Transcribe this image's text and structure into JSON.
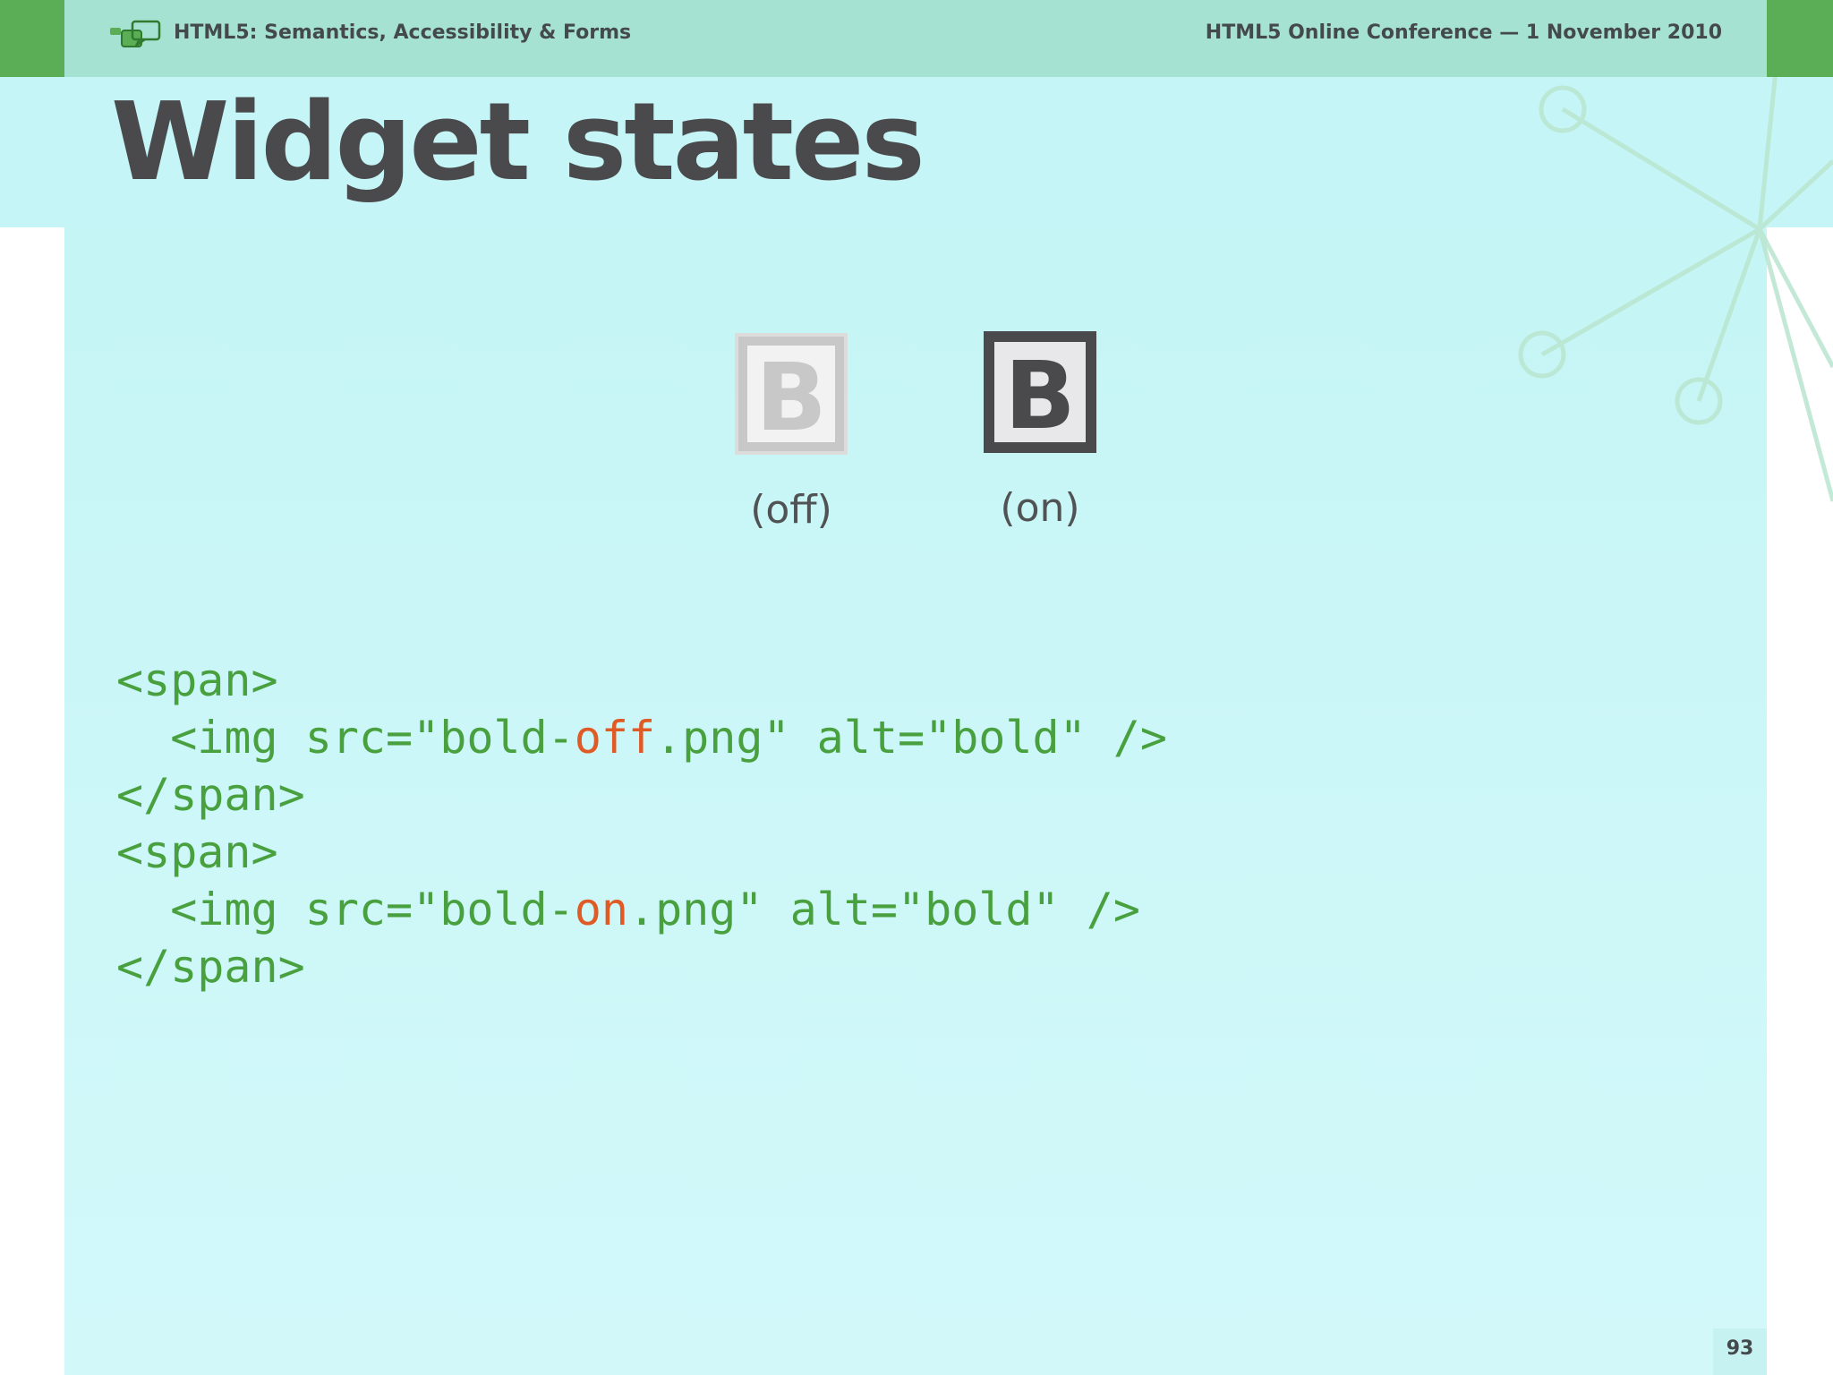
{
  "header": {
    "left_title": "HTML5: Semantics, Accessibility & Forms",
    "right_title": "HTML5 Online Conference — 1 November 2010"
  },
  "slide": {
    "title": "Widget states",
    "page_number": "93"
  },
  "states": {
    "off": {
      "glyph": "B",
      "label": "(off)"
    },
    "on": {
      "glyph": "B",
      "label": "(on)"
    }
  },
  "code": {
    "lines": [
      {
        "text": "<span>"
      },
      {
        "before": "  <img src=\"bold-",
        "highlight": "off",
        "after": ".png\" alt=\"bold\" />"
      },
      {
        "text": "</span>"
      },
      {
        "text": "<span>"
      },
      {
        "before": "  <img src=\"bold-",
        "highlight": "on",
        "after": ".png\" alt=\"bold\" />"
      },
      {
        "text": "</span>"
      }
    ]
  },
  "colors": {
    "header_bar": "#a6e2d2",
    "corner_green": "#5bae55",
    "panel": "#c8f5f6",
    "title_text": "#4a4a4c",
    "code_green": "#49a03f",
    "code_highlight": "#e05a26",
    "icon_off": "#c8c8c8",
    "icon_on": "#4a4a4c"
  },
  "icons": {
    "logo": "speech-bubbles-icon",
    "decoration": "network-nodes-decoration"
  }
}
